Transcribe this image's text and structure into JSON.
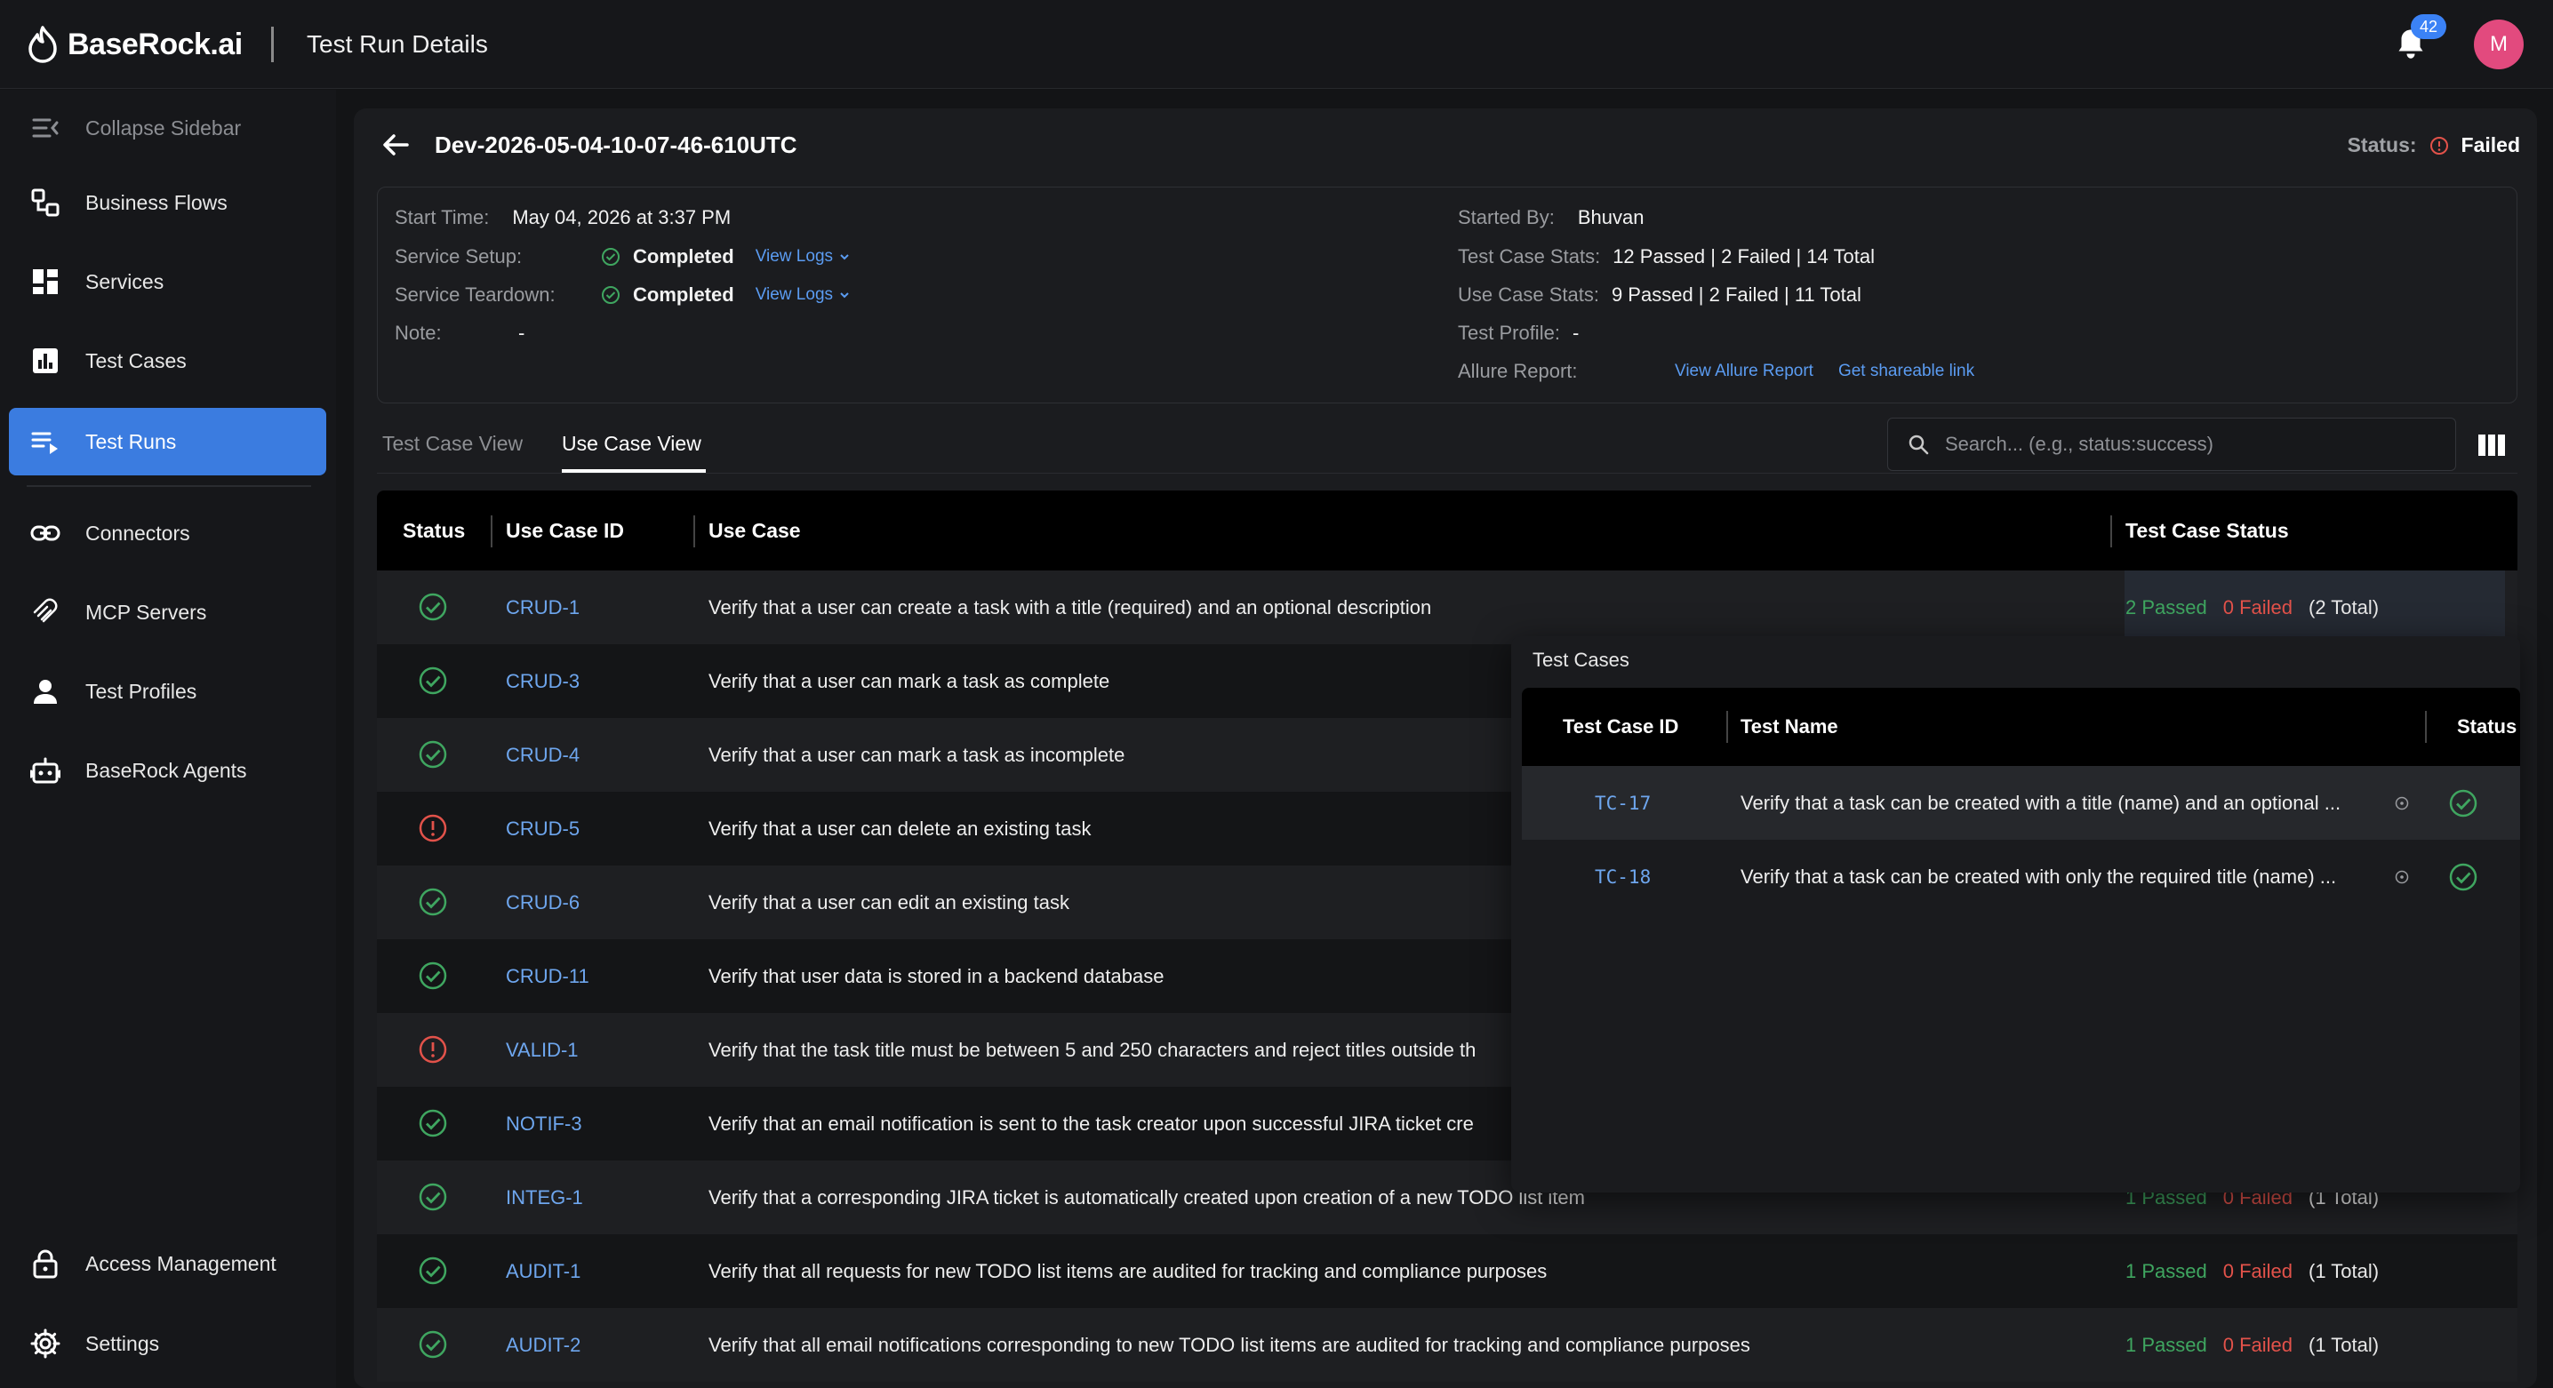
{
  "header": {
    "brand": "BaseRock.ai",
    "page_title": "Test Run Details",
    "notification_count": "42",
    "avatar_initial": "M"
  },
  "sidebar": {
    "collapse_label": "Collapse Sidebar",
    "items": [
      {
        "label": "Business Flows",
        "icon": "business-flows-icon"
      },
      {
        "label": "Services",
        "icon": "services-icon"
      },
      {
        "label": "Test Cases",
        "icon": "test-cases-icon"
      },
      {
        "label": "Test Runs",
        "icon": "test-runs-icon",
        "active": true
      },
      {
        "label": "Connectors",
        "icon": "link-icon"
      },
      {
        "label": "MCP Servers",
        "icon": "mcp-icon"
      },
      {
        "label": "Test Profiles",
        "icon": "user-icon"
      },
      {
        "label": "BaseRock Agents",
        "icon": "robot-icon"
      }
    ],
    "bottom": [
      {
        "label": "Access Management",
        "icon": "lock-icon"
      },
      {
        "label": "Settings",
        "icon": "gear-icon"
      }
    ]
  },
  "run": {
    "name": "Dev-2026-05-04-10-07-46-610UTC",
    "status_label": "Status:",
    "status_value": "Failed",
    "start_time_label": "Start Time:",
    "start_time": "May 04, 2026 at 3:37 PM",
    "setup_label": "Service Setup:",
    "setup_value": "Completed",
    "teardown_label": "Service Teardown:",
    "teardown_value": "Completed",
    "view_logs": "View Logs",
    "note_label": "Note:",
    "note_value": "-",
    "started_by_label": "Started By:",
    "started_by": "Bhuvan",
    "tc_stats_label": "Test Case Stats:",
    "tc_stats": "12 Passed | 2 Failed | 14 Total",
    "uc_stats_label": "Use Case Stats:",
    "uc_stats": "9 Passed | 2 Failed | 11 Total",
    "profile_label": "Test Profile:",
    "profile_value": "-",
    "allure_label": "Allure Report:",
    "allure_link": "View Allure Report",
    "share_link": "Get shareable link"
  },
  "tabs": {
    "tab1": "Test Case View",
    "tab2": "Use Case View",
    "active": "Use Case View"
  },
  "search": {
    "placeholder": "Search... (e.g., status:success)"
  },
  "table": {
    "headers": {
      "status": "Status",
      "id": "Use Case ID",
      "use_case": "Use Case",
      "tc_status": "Test Case Status"
    },
    "rows": [
      {
        "status": "passed",
        "id": "CRUD-1",
        "use_case": "Verify that a user can create a task with a title (required) and an optional description",
        "passed": "2 Passed",
        "failed": "0 Failed",
        "total": "(2 Total)"
      },
      {
        "status": "passed",
        "id": "CRUD-3",
        "use_case": "Verify that a user can mark a task as complete",
        "passed": "",
        "failed": "",
        "total": ""
      },
      {
        "status": "passed",
        "id": "CRUD-4",
        "use_case": "Verify that a user can mark a task as incomplete",
        "passed": "",
        "failed": "",
        "total": ""
      },
      {
        "status": "failed",
        "id": "CRUD-5",
        "use_case": "Verify that a user can delete an existing task",
        "passed": "",
        "failed": "",
        "total": ""
      },
      {
        "status": "passed",
        "id": "CRUD-6",
        "use_case": "Verify that a user can edit an existing task",
        "passed": "",
        "failed": "",
        "total": ""
      },
      {
        "status": "passed",
        "id": "CRUD-11",
        "use_case": "Verify that user data is stored in a backend database",
        "passed": "",
        "failed": "",
        "total": ""
      },
      {
        "status": "failed",
        "id": "VALID-1",
        "use_case": "Verify that the task title must be between 5 and 250 characters and reject titles outside th",
        "passed": "",
        "failed": "",
        "total": ""
      },
      {
        "status": "passed",
        "id": "NOTIF-3",
        "use_case": "Verify that an email notification is sent to the task creator upon successful JIRA ticket cre",
        "passed": "",
        "failed": "",
        "total": ""
      },
      {
        "status": "passed",
        "id": "INTEG-1",
        "use_case": "Verify that a corresponding JIRA ticket is automatically created upon creation of a new TODO list item",
        "passed": "1 Passed",
        "failed": "0 Failed",
        "total": "(1 Total)"
      },
      {
        "status": "passed",
        "id": "AUDIT-1",
        "use_case": "Verify that all requests for new TODO list items are audited for tracking and compliance purposes",
        "passed": "1 Passed",
        "failed": "0 Failed",
        "total": "(1 Total)"
      },
      {
        "status": "passed",
        "id": "AUDIT-2",
        "use_case": "Verify that all email notifications corresponding to new TODO list items are audited for tracking and compliance purposes",
        "passed": "1 Passed",
        "failed": "0 Failed",
        "total": "(1 Total)"
      }
    ]
  },
  "popover": {
    "title": "Test Cases",
    "headers": {
      "id": "Test Case ID",
      "name": "Test Name",
      "status": "Status"
    },
    "rows": [
      {
        "id": "TC-17",
        "name": "Verify that a task can be created with a title (name) and an optional ...",
        "status": "passed"
      },
      {
        "id": "TC-18",
        "name": "Verify that a task can be created with only the required title (name) ...",
        "status": "passed"
      }
    ]
  },
  "colors": {
    "accent": "#3b7ce0",
    "pass": "#3fa660",
    "fail": "#e2524a",
    "link": "#6ea6ee"
  }
}
